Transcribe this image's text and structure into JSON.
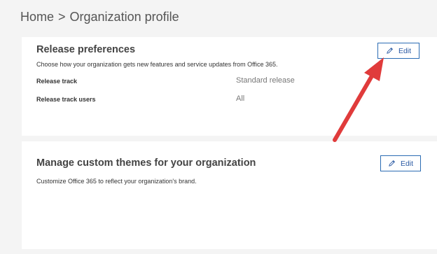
{
  "breadcrumb": {
    "home": "Home",
    "separator": ">",
    "current": "Organization profile"
  },
  "release_card": {
    "title": "Release preferences",
    "description": "Choose how your organization gets new features and service updates from Office 365.",
    "edit_label": "Edit",
    "rows": [
      {
        "label": "Release track",
        "value": "Standard release"
      },
      {
        "label": "Release track users",
        "value": "All"
      }
    ]
  },
  "themes_card": {
    "title": "Manage custom themes for your organization",
    "description": "Customize Office 365 to reflect your organization's brand.",
    "edit_label": "Edit"
  },
  "icons": {
    "edit": "pencil-icon",
    "annotation": "arrow"
  },
  "colors": {
    "accent": "#2b6cb3",
    "annotation_arrow": "#e03b3b"
  }
}
